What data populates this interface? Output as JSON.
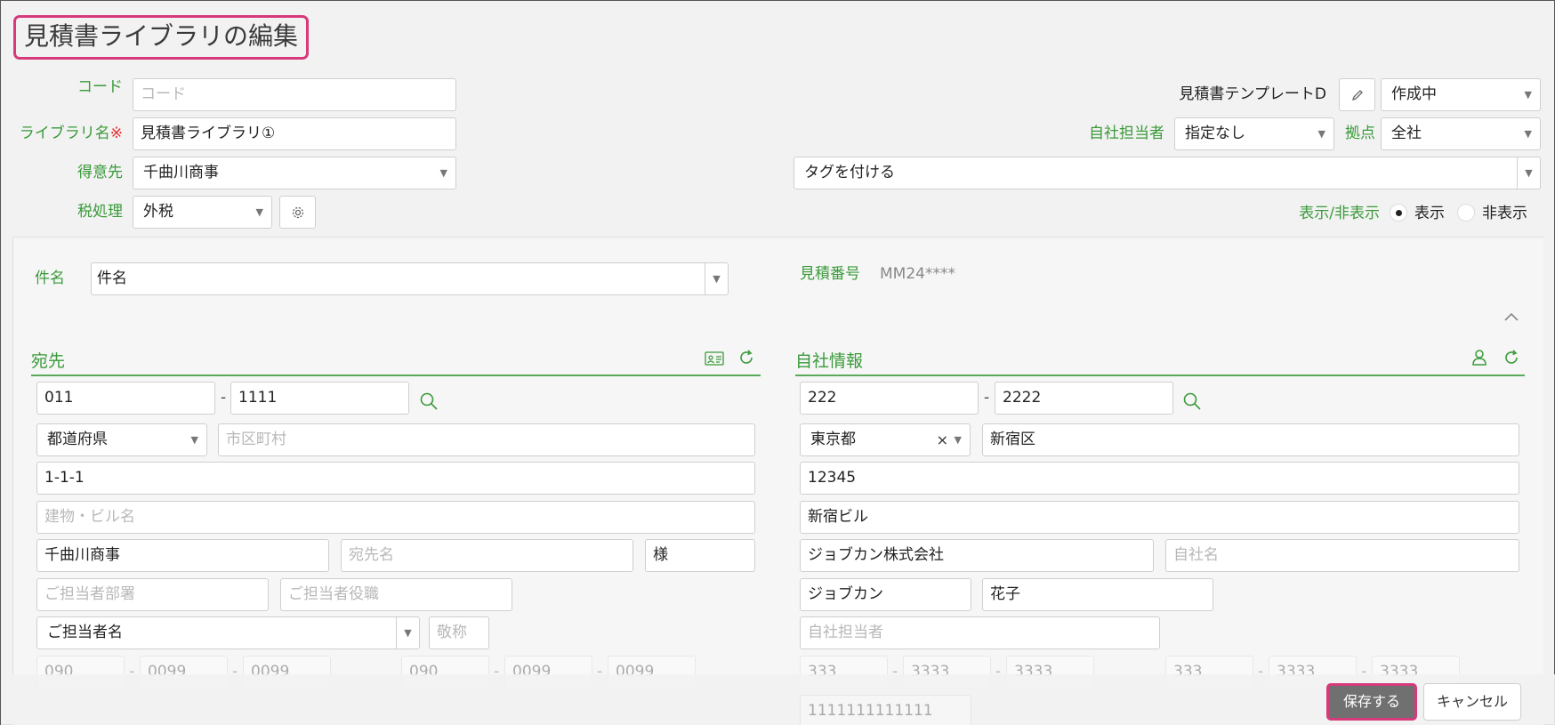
{
  "page_title": "見積書ライブラリの編集",
  "header": {
    "code_label": "コード",
    "code_placeholder": "コード",
    "library_name_label": "ライブラリ名",
    "required_mark": "※",
    "library_name_value": "見積書ライブラリ①",
    "customer_label": "得意先",
    "customer_value": "千曲川商事",
    "tax_label": "税処理",
    "tax_value": "外税",
    "template_name": "見積書テンプレートD",
    "status_value": "作成中",
    "staff_label": "自社担当者",
    "staff_value": "指定なし",
    "base_label": "拠点",
    "base_value": "全社",
    "tag_placeholder": "タグを付ける",
    "visibility_label": "表示/非表示",
    "visibility_show": "表示",
    "visibility_hide": "非表示",
    "visibility_selected": "表示"
  },
  "form": {
    "subject_label": "件名",
    "subject_placeholder": "件名",
    "quote_number_label": "見積番号",
    "quote_number_value": "MM24****"
  },
  "recipient": {
    "section_title": "宛先",
    "postal1": "011",
    "postal2": "1111",
    "prefecture_placeholder": "都道府県",
    "city_placeholder": "市区町村",
    "address": "1-1-1",
    "building_placeholder": "建物・ビル名",
    "company": "千曲川商事",
    "name_placeholder": "宛先名",
    "honorific": "様",
    "dept_placeholder": "ご担当者部署",
    "position_placeholder": "ご担当者役職",
    "contact_placeholder": "ご担当者名",
    "title_placeholder": "敬称",
    "tel1": "090",
    "tel2": "0099",
    "tel3": "0099",
    "fax1": "090",
    "fax2": "0099",
    "fax3": "0099"
  },
  "own": {
    "section_title": "自社情報",
    "postal1": "222",
    "postal2": "2222",
    "prefecture": "東京都",
    "clear_mark": "×",
    "city": "新宿区",
    "address": "12345",
    "building": "新宿ビル",
    "company": "ジョブカン株式会社",
    "name_placeholder": "自社名",
    "last_name": "ジョブカン",
    "first_name": "花子",
    "staff_placeholder": "自社担当者",
    "tel1": "333",
    "tel2": "3333",
    "tel3": "3333",
    "fax1": "333",
    "fax2": "3333",
    "fax3": "3333",
    "extra": "1111111111111"
  },
  "footer": {
    "save_label": "保存する",
    "cancel_label": "キャンセル"
  },
  "misc": {
    "dash": "-"
  },
  "colors": {
    "accent_green": "#3a9a3a",
    "highlight_pink": "#d63a7a",
    "save_button": "#707070"
  }
}
